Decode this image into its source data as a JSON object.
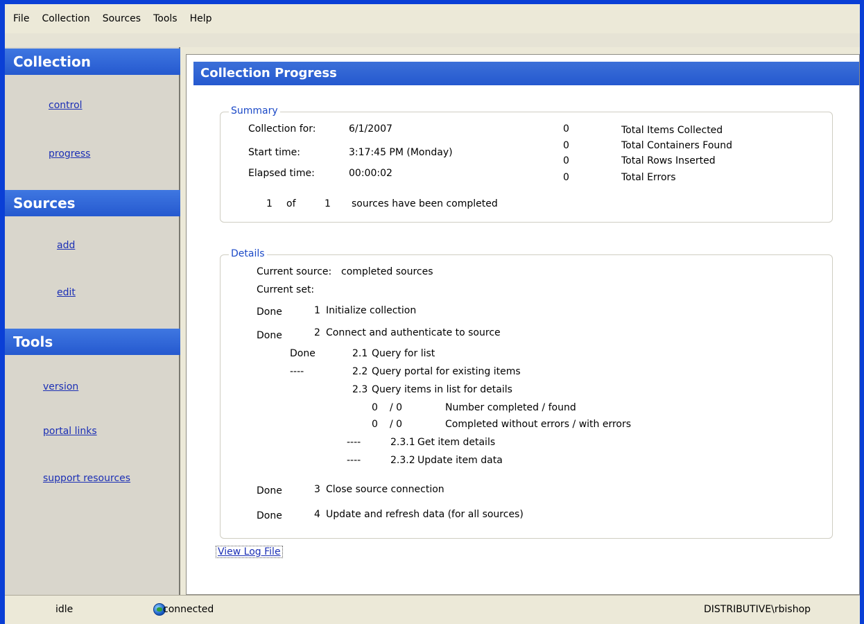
{
  "menubar": {
    "items": [
      "File",
      "Collection",
      "Sources",
      "Tools",
      "Help"
    ]
  },
  "sidebar": {
    "collection": {
      "title": "Collection",
      "links": [
        "control",
        "progress"
      ]
    },
    "sources": {
      "title": "Sources",
      "links": [
        "add",
        "edit"
      ]
    },
    "tools": {
      "title": "Tools",
      "links": [
        "version",
        "portal links",
        "support resources"
      ]
    }
  },
  "main": {
    "title": "Collection Progress",
    "summary": {
      "legend": "Summary",
      "collection_for_label": "Collection for:",
      "collection_for_value": "6/1/2007",
      "start_time_label": "Start time:",
      "start_time_value": "3:17:45 PM (Monday)",
      "elapsed_label": "Elapsed time:",
      "elapsed_value": "00:00:02",
      "stats": [
        {
          "count": "0",
          "label": "Total Items Collected"
        },
        {
          "count": "0",
          "label": "Total Containers Found"
        },
        {
          "count": "0",
          "label": "Total Rows Inserted"
        },
        {
          "count": "0",
          "label": "Total Errors"
        }
      ],
      "sources_done": "1",
      "of_label": "of",
      "sources_total": "1",
      "sources_text": "sources have been completed"
    },
    "details": {
      "legend": "Details",
      "current_source_label": "Current source:",
      "current_source_value": "completed sources",
      "current_set_label": "Current set:",
      "steps": [
        {
          "status": "Done",
          "num": "1",
          "text": "Initialize collection"
        },
        {
          "status": "Done",
          "num": "2",
          "text": "Connect and authenticate to source"
        },
        {
          "status": "Done",
          "num": "2.1",
          "text": "Query for list"
        },
        {
          "status": "----",
          "num": "2.2",
          "text": "Query portal for existing items"
        },
        {
          "status": "",
          "num": "2.3",
          "text": "Query items in list for details"
        },
        {
          "status": "----",
          "num": "2.3.1",
          "text": "Get item details"
        },
        {
          "status": "----",
          "num": "2.3.2",
          "text": "Update item data"
        },
        {
          "status": "Done",
          "num": "3",
          "text": "Close source connection"
        },
        {
          "status": "Done",
          "num": "4",
          "text": "Update and refresh data (for all sources)"
        }
      ],
      "counters": [
        {
          "a": "0",
          "b": "/ 0",
          "label": "Number completed / found"
        },
        {
          "a": "0",
          "b": "/ 0",
          "label": "Completed without errors / with errors"
        }
      ]
    },
    "view_log": "View Log File"
  },
  "statusbar": {
    "state": "idle",
    "connection": "connected",
    "user": "DISTRIBUTIVE\\rbishop"
  }
}
